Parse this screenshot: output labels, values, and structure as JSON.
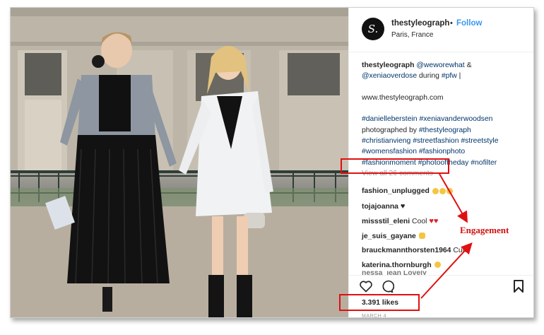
{
  "post": {
    "username": "thestyleograph",
    "separator": "•",
    "follow_label": "Follow",
    "location": "Paris, France",
    "avatar_letter": "S."
  },
  "caption": {
    "user": "thestyleograph",
    "mention1": "@weworewhat",
    "amp": " &",
    "mention2": "@xeniaoverdose",
    "during": " during ",
    "tag_pfw": "#pfw",
    "bar": " |",
    "url": "www.thestyleograph.com",
    "tag_line1": "#danielleberstein #xeniavanderwoodsen",
    "photographed": "photographed by ",
    "photographed_tag": "#thestyleograph",
    "tag_line3": "#christianvieng #streetfashion #streetstyle",
    "tag_line4": "#womensfashion #fashionphoto",
    "tag_line5": "#fashionmoment #photooftheday #nofilter"
  },
  "view_all_comments": "View all 26 comments",
  "comments": [
    {
      "user": "fashion_unplugged",
      "text": "",
      "emoji": [
        "clap-emoji",
        "clap-emoji",
        "clap-emoji"
      ]
    },
    {
      "user": "tojajoanna",
      "text": "",
      "emoji": [
        "black-heart-emoji"
      ]
    },
    {
      "user": "missstil_eleni",
      "text": "Cool",
      "emoji": [
        "heart-eyes-emoji",
        "heart-eyes-emoji"
      ]
    },
    {
      "user": "je_suis_gayane",
      "text": "",
      "emoji": [
        "hand-emoji"
      ]
    },
    {
      "user": "brauckmannthorsten1964",
      "text": "Cute",
      "emoji": []
    },
    {
      "user": "katerina.thornburgh",
      "text": "",
      "emoji": [
        "sunglasses-emoji"
      ]
    }
  ],
  "partial_comment": "nessa_jean  Lovely",
  "likes": "3.391 likes",
  "date_partial": "MARCH 4",
  "annotation": "Engagement",
  "colors": {
    "annotation_red": "#e01010",
    "link_blue": "#3897f0",
    "hashtag_navy": "#003569"
  },
  "icons": [
    "heart-icon",
    "comment-icon",
    "bookmark-icon"
  ]
}
